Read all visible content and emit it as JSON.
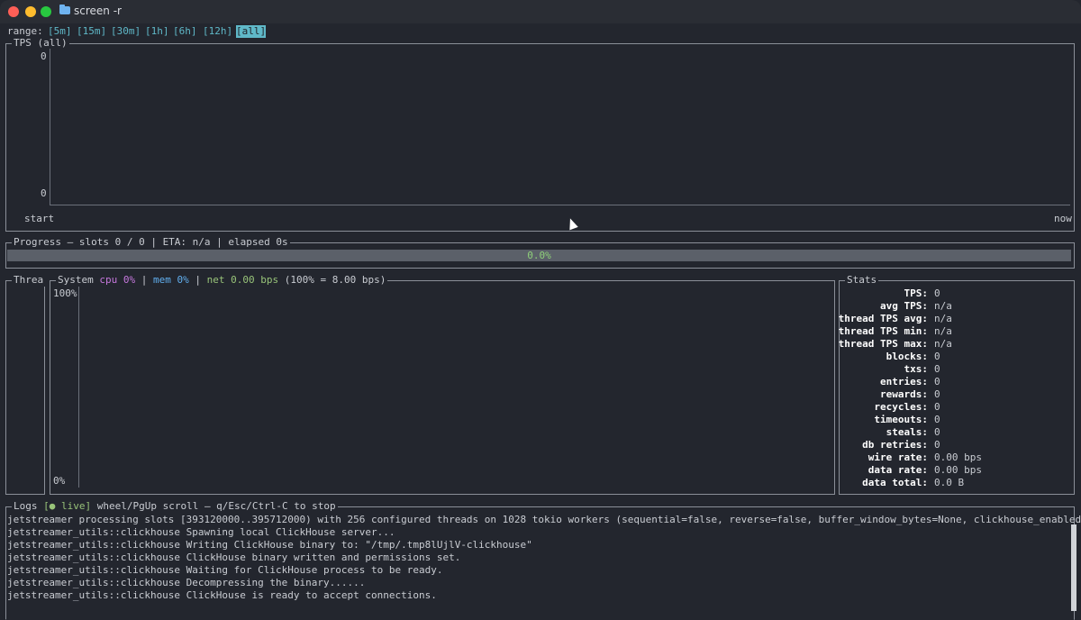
{
  "window": {
    "title": "screen -r"
  },
  "range": {
    "label": "range:",
    "options": [
      "[5m]",
      "[15m]",
      "[30m]",
      "[1h]",
      "[6h]",
      "[12h]",
      "[all]"
    ],
    "active": "[all]"
  },
  "tps": {
    "title": "TPS (all)",
    "y_top": "0",
    "y_bottom": "0",
    "x_start": "start",
    "x_end": "now"
  },
  "progress": {
    "title": "Progress — slots 0 / 0 | ETA: n/a | elapsed 0s",
    "percent_text": "0.0%",
    "fraction": 0.0
  },
  "threads": {
    "title": "Threa"
  },
  "system": {
    "title": "System",
    "cpu_label": "cpu 0%",
    "sep1": "|",
    "mem_label": "mem 0%",
    "sep2": "|",
    "net_label": "net 0.00 bps",
    "net_scale": "(100% = 8.00 bps)",
    "y_top": "100%",
    "y_bottom": "0%"
  },
  "stats": {
    "title": "Stats",
    "rows": [
      {
        "key": "TPS:",
        "value": "0"
      },
      {
        "key": "avg TPS:",
        "value": "n/a"
      },
      {
        "key": "thread TPS avg:",
        "value": "n/a"
      },
      {
        "key": "thread TPS min:",
        "value": "n/a"
      },
      {
        "key": "thread TPS max:",
        "value": "n/a"
      },
      {
        "key": "blocks:",
        "value": "0"
      },
      {
        "key": "txs:",
        "value": "0"
      },
      {
        "key": "entries:",
        "value": "0"
      },
      {
        "key": "rewards:",
        "value": "0"
      },
      {
        "key": "recycles:",
        "value": "0"
      },
      {
        "key": "timeouts:",
        "value": "0"
      },
      {
        "key": "steals:",
        "value": "0"
      },
      {
        "key": "db retries:",
        "value": "0"
      },
      {
        "key": "wire rate:",
        "value": "0.00 bps"
      },
      {
        "key": "data rate:",
        "value": "0.00 bps"
      },
      {
        "key": "data total:",
        "value": "0.0 B"
      }
    ]
  },
  "logs": {
    "title": "Logs",
    "live": "[● live]",
    "hint": "wheel/PgUp scroll — q/Esc/Ctrl-C to stop",
    "lines": [
      "jetstreamer processing slots [393120000..395712000) with 256 configured threads on 1028 tokio workers (sequential=false, reverse=false, buffer_window_bytes=None, clickhouse_enabled=true)",
      "jetstreamer_utils::clickhouse Spawning local ClickHouse server...",
      "jetstreamer_utils::clickhouse Writing ClickHouse binary to: \"/tmp/.tmp8lUjlV-clickhouse\"",
      "jetstreamer_utils::clickhouse ClickHouse binary written and permissions set.",
      "jetstreamer_utils::clickhouse Waiting for ClickHouse process to be ready.",
      "jetstreamer_utils::clickhouse Decompressing the binary......",
      "jetstreamer_utils::clickhouse ClickHouse is ready to accept connections."
    ]
  },
  "colors": {
    "accent_cyan": "#5fb8c8",
    "cpu": "#c678dd",
    "mem": "#61afef",
    "net": "#98c379",
    "progress_text": "#8fd07a"
  }
}
